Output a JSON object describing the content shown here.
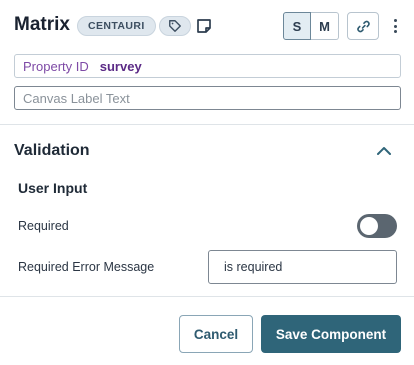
{
  "header": {
    "title": "Matrix",
    "badge": "CENTAURI",
    "size_options": [
      "S",
      "M"
    ],
    "icons": [
      "tag-icon",
      "note-icon",
      "link-icon",
      "kebab-menu-icon"
    ]
  },
  "property_id": {
    "label": "Property ID",
    "value": "survey"
  },
  "canvas_label": {
    "placeholder": "Canvas Label Text",
    "value": ""
  },
  "validation": {
    "title": "Validation",
    "subtitle": "User Input",
    "required_label": "Required",
    "required_on": false,
    "error_message_label": "Required Error Message",
    "error_message_value": "is required"
  },
  "footer": {
    "cancel_label": "Cancel",
    "save_label": "Save Component"
  },
  "colors": {
    "accent": "#2f6579",
    "property_label": "#7e4aa6",
    "property_value": "#5b2a86",
    "toggle_off": "#5b6670"
  }
}
